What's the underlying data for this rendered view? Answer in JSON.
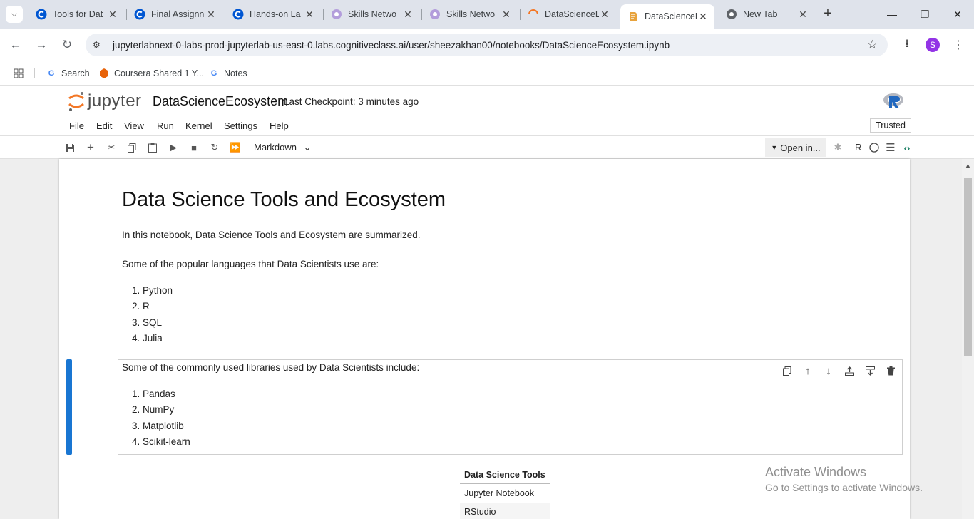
{
  "browser": {
    "tabs": [
      {
        "title": "Tools for Dat",
        "favicon": "coursera-c-icon"
      },
      {
        "title": "Final Assignn",
        "favicon": "coursera-c-icon"
      },
      {
        "title": "Hands-on La",
        "favicon": "coursera-c-icon"
      },
      {
        "title": "Skills Netwo",
        "favicon": "skills-network-icon"
      },
      {
        "title": "Skills Netwo",
        "favicon": "skills-network-icon"
      },
      {
        "title": "DataScienceE",
        "favicon": "jupyter-loading-icon"
      },
      {
        "title": "DataScienceE",
        "favicon": "notebook-icon",
        "active": true
      },
      {
        "title": "New Tab",
        "favicon": "chrome-icon"
      }
    ],
    "url": "jupyterlabnext-0-labs-prod-jupyterlab-us-east-0.labs.cognitiveclass.ai/user/sheezakhan00/notebooks/DataScienceEcosystem.ipynb",
    "profile_initial": "S",
    "bookmarks": [
      {
        "label": "Search",
        "icon": "google-icon"
      },
      {
        "label": "Coursera Shared 1 Y...",
        "icon": "coursera-shared-icon"
      },
      {
        "label": "Notes",
        "icon": "google-icon"
      }
    ]
  },
  "jupyter": {
    "logo_text": "jupyter",
    "notebook_title": "DataScienceEcosystem",
    "checkpoint": "Last Checkpoint: 3 minutes ago",
    "menu": [
      "File",
      "Edit",
      "View",
      "Run",
      "Kernel",
      "Settings",
      "Help"
    ],
    "trusted": "Trusted",
    "cell_type": "Markdown",
    "open_in": "Open in...",
    "kernel_name": "R"
  },
  "notebook": {
    "heading": "Data Science Tools and Ecosystem",
    "intro": "In this notebook, Data Science Tools and Ecosystem are summarized.",
    "languages_intro": "Some of the popular languages that Data Scientists use are:",
    "languages": [
      "1. Python",
      "2. R",
      "3. SQL",
      "4. Julia"
    ],
    "libraries_intro": "Some of the commonly used libraries used by Data Scientists include:",
    "libraries": [
      "1. Pandas",
      "2. NumPy",
      "3. Matplotlib",
      "4. Scikit-learn"
    ],
    "tools_table": {
      "header": "Data Science Tools",
      "rows": [
        "Jupyter Notebook",
        "RStudio"
      ]
    }
  },
  "watermark": {
    "line1": "Activate Windows",
    "line2": "Go to Settings to activate Windows."
  },
  "colors": {
    "active_cell_bar": "#1976d2",
    "jupyter_orange": "#f37726",
    "profile": "#9334e6"
  }
}
